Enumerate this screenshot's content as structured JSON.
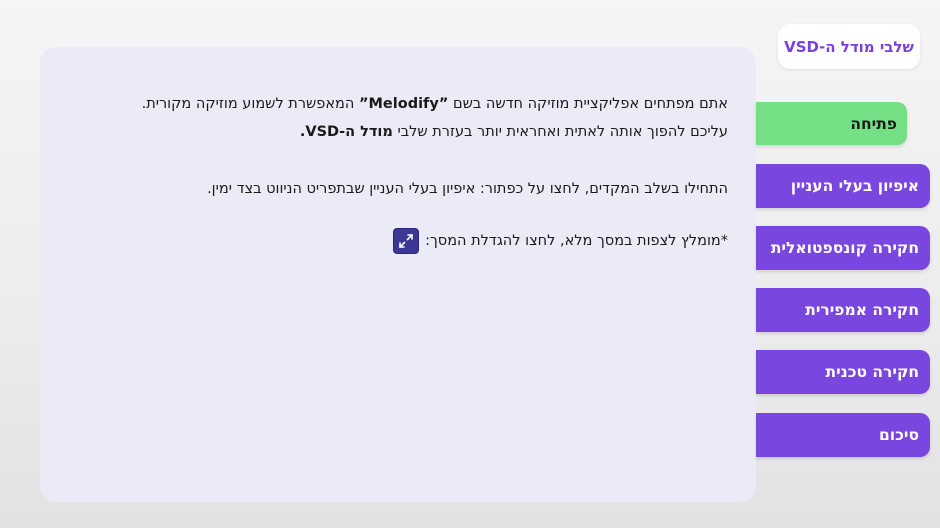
{
  "sidebar": {
    "title": "שלבי מודל ה-VSD",
    "items": [
      {
        "label": "פתיחה",
        "active": true
      },
      {
        "label": "איפיון בעלי העניין",
        "active": false
      },
      {
        "label": "חקירה קונספטואלית",
        "active": false
      },
      {
        "label": "חקירה אמפירית",
        "active": false
      },
      {
        "label": "חקירה טכנית",
        "active": false
      },
      {
        "label": "סיכום",
        "active": false
      }
    ]
  },
  "content": {
    "line1_before": "אתם מפתחים אפליקציית מוזיקה חדשה בשם ",
    "line1_bold": "”Melodify”",
    "line1_after": " המאפשרת לשמוע מוזיקה מקורית.",
    "line2_before": "עליכם להפוך אותה לאתית ואחראית יותר בעזרת שלבי ",
    "line2_bold": "מודל ה-VSD.",
    "instruction": "התחילו בשלב המקדים, לחצו על כפתור: איפיון בעלי העניין שבתפריט הניווט בצד ימין.",
    "fullscreen_note": "*מומלץ לצפות במסך מלא, לחצו להגדלת המסך:"
  },
  "colors": {
    "accent_purple": "#7a46e0",
    "active_green": "#74df85",
    "panel_bg": "#ebebf7",
    "fullscreen_button": "#3a3893"
  },
  "icons": {
    "fullscreen": "expand-arrows-icon"
  }
}
